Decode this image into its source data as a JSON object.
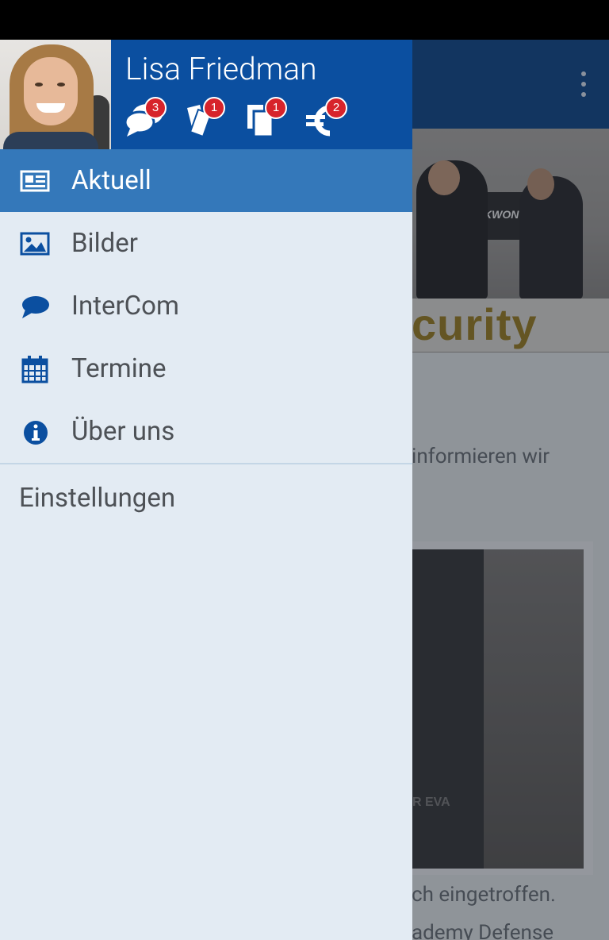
{
  "user": {
    "name": "Lisa Friedman",
    "badges": [
      {
        "icon": "chat-bubbles-icon",
        "count": "3"
      },
      {
        "icon": "tickets-icon",
        "count": "1"
      },
      {
        "icon": "documents-icon",
        "count": "1"
      },
      {
        "icon": "euro-icon",
        "count": "2"
      }
    ]
  },
  "nav": {
    "items": [
      {
        "label": "Aktuell",
        "icon": "news-icon",
        "active": true
      },
      {
        "label": "Bilder",
        "icon": "image-icon",
        "active": false
      },
      {
        "label": "InterCom",
        "icon": "speech-bubble-icon",
        "active": false
      },
      {
        "label": "Termine",
        "icon": "calendar-icon",
        "active": false
      },
      {
        "label": "Über uns",
        "icon": "info-icon",
        "active": false
      }
    ],
    "settings_label": "Einstellungen"
  },
  "background": {
    "banner_logo": "KWON",
    "banner_heading": "curity",
    "text_1": "informieren wir",
    "text_2": "ch eingetroffen.",
    "text_3": "ademy Defense",
    "card_label": "R EVA"
  },
  "colors": {
    "toolbar": "#063b7a",
    "drawer_header": "#0b4fa0",
    "active_item": "#3478ba",
    "drawer_bg": "#e3ebf3",
    "badge": "#d7232b",
    "icon": "#0b4fa0"
  }
}
